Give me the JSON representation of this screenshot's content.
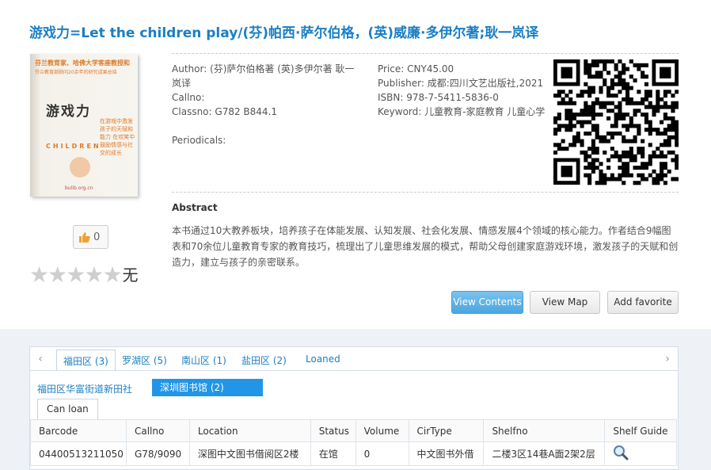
{
  "book": {
    "title": "游戏力=Let the children play/(芬)帕西·萨尔伯格，(英)威廉·多伊尔著;耿一岚译",
    "cover": {
      "line1": "芬兰教育家、哈佛大学客座教授和",
      "line2": "芬兰教育部顾问20余年的研究成果总结",
      "book_name": "游戏力",
      "english": "CHILDREN",
      "tagline": "在游戏中激发孩子的天赋和能力 在欢笑中鼓励情感与社交的成长",
      "watermark": "bulib.org.cn"
    },
    "author_label": "Author:",
    "author_value": "(芬)萨尔伯格著  (英)多伊尔著  耿一岚译",
    "callno_label": "Callno:",
    "callno_value": "",
    "classno_label": "Classno:",
    "classno_value": "G782   B844.1",
    "periodicals_label": "Periodicals:",
    "periodicals_value": "",
    "price_label": "Price:",
    "price_value": "CNY45.00",
    "publisher_label": "Publisher:",
    "publisher_value": "成都:四川文艺出版社,2021",
    "isbn_label": "ISBN:",
    "isbn_value": "978-7-5411-5836-0",
    "keyword_label": "Keyword:",
    "keyword_value": "儿童教育-家庭教育  儿童心学"
  },
  "abstract": {
    "title": "Abstract",
    "text": "本书通过10大教养板块，培养孩子在体能发展、认知发展、社会化发展、情感发展4个领域的核心能力。作者结合9幅图表和70余位儿童教育专家的教育技巧，梳理出了儿童思维发展的模式，帮助父母创建家庭游戏环境，激发孩子的天赋和创造力，建立与孩子的亲密联系。"
  },
  "actions": {
    "view_contents": "View Contents",
    "view_map": "View Map",
    "add_favorite": "Add favorite"
  },
  "likes": {
    "count": "0"
  },
  "rating": {
    "stars": 0,
    "max": 5,
    "label": "无"
  },
  "tabs": [
    {
      "label": "福田区 (3)",
      "active": true
    },
    {
      "label": "罗湖区 (5)",
      "active": false
    },
    {
      "label": "南山区 (1)",
      "active": false
    },
    {
      "label": "盐田区 (2)",
      "active": false
    },
    {
      "label": "Loaned",
      "active": false
    }
  ],
  "libraries": {
    "link": "福田区华富街道新田社",
    "active": "深圳图书馆 (2)"
  },
  "loan_tab": "Can loan",
  "table": {
    "headers": [
      "Barcode",
      "Callno",
      "Location",
      "Status",
      "Volume",
      "CirType",
      "Shelfno",
      "Shelf Guide"
    ],
    "rows": [
      [
        "04400513211050",
        "G78/9090",
        "深图中文图书借阅区2楼",
        "在馆",
        "0",
        "中文图书外借",
        "二楼3区14巷A面2架2层",
        ""
      ]
    ]
  },
  "colors": {
    "link": "#1a7fc4",
    "primary_button": "#4aa6df",
    "active_library": "#2196e8"
  }
}
